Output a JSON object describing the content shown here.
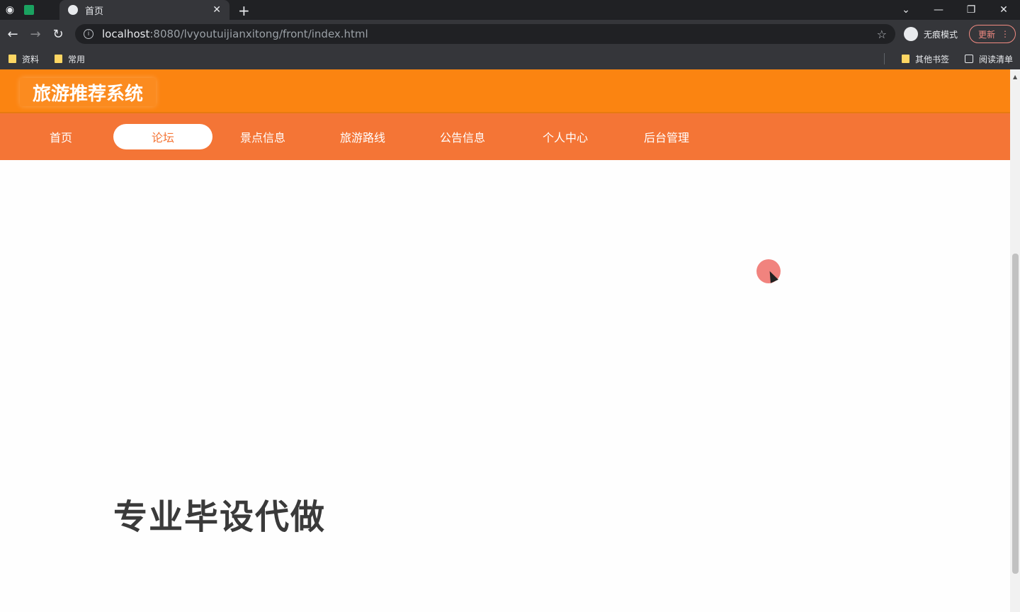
{
  "browser": {
    "tab_title": "首页",
    "url_host": "localhost",
    "url_path": ":8080/lvyoutuijianxitong/front/index.html",
    "incognito_label": "无痕模式",
    "update_label": "更新",
    "bookmarks": [
      {
        "label": "资料"
      },
      {
        "label": "常用"
      }
    ],
    "other_bookmarks": "其他书签",
    "reading_list": "阅读清单"
  },
  "site": {
    "logo": "旅游推荐系统",
    "nav": [
      {
        "label": "首页"
      },
      {
        "label": "论坛",
        "active": true
      },
      {
        "label": "景点信息"
      },
      {
        "label": "旅游路线"
      },
      {
        "label": "公告信息"
      },
      {
        "label": "个人中心"
      },
      {
        "label": "后台管理"
      }
    ]
  },
  "overlay": {
    "watermark": "专业毕设代做"
  },
  "colors": {
    "header": "#fb8411",
    "nav": "#f47536",
    "active_nav_bg": "#ffffff"
  }
}
